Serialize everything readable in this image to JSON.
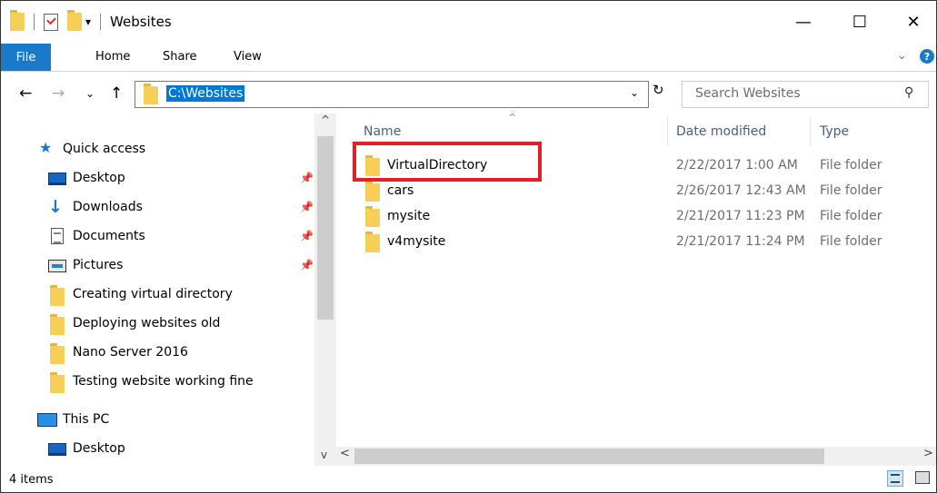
{
  "window": {
    "title": "Websites",
    "qa_dropdown": "▾",
    "controls": {
      "minimize": "—",
      "maximize": "☐",
      "close": "✕"
    }
  },
  "ribbon": {
    "tabs": [
      "File",
      "Home",
      "Share",
      "View"
    ],
    "chevron": "⌄",
    "help": "?"
  },
  "nav": {
    "back": "←",
    "forward": "→",
    "recent": "⌄",
    "up": "↑"
  },
  "address": {
    "path": "C:\\Websites",
    "dropdown": "⌄",
    "refresh": "↻"
  },
  "search": {
    "placeholder": "Search Websites",
    "icon": "⚲"
  },
  "navpane": {
    "quick_access": "Quick access",
    "pinned": [
      {
        "label": "Desktop",
        "icon": "desktop-icon"
      },
      {
        "label": "Downloads",
        "icon": "downloads-icon"
      },
      {
        "label": "Documents",
        "icon": "documents-icon"
      },
      {
        "label": "Pictures",
        "icon": "pictures-icon"
      }
    ],
    "pin_glyph": "📌",
    "folders": [
      "Creating  virtual directory",
      "Deploying websites old",
      "Nano Server 2016",
      "Testing website working fine"
    ],
    "this_pc": "This PC",
    "pc_desktop": "Desktop"
  },
  "columns": {
    "name": "Name",
    "date": "Date modified",
    "type": "Type",
    "sort_indicator": "^"
  },
  "files": [
    {
      "name": "VirtualDirectory",
      "date": "2/22/2017 1:00 AM",
      "type": "File folder"
    },
    {
      "name": "cars",
      "date": "2/26/2017 12:43 AM",
      "type": "File folder"
    },
    {
      "name": "mysite",
      "date": "2/21/2017 11:23 PM",
      "type": "File folder"
    },
    {
      "name": "v4mysite",
      "date": "2/21/2017 11:24 PM",
      "type": "File folder"
    }
  ],
  "scroll": {
    "up": "^",
    "down": "v",
    "left": "<",
    "right": ">"
  },
  "status": {
    "count": "4 items"
  },
  "colors": {
    "accent": "#1979ca",
    "selection": "#0078d7",
    "highlight_box": "#e01f26",
    "folder": "#f6cf59"
  }
}
